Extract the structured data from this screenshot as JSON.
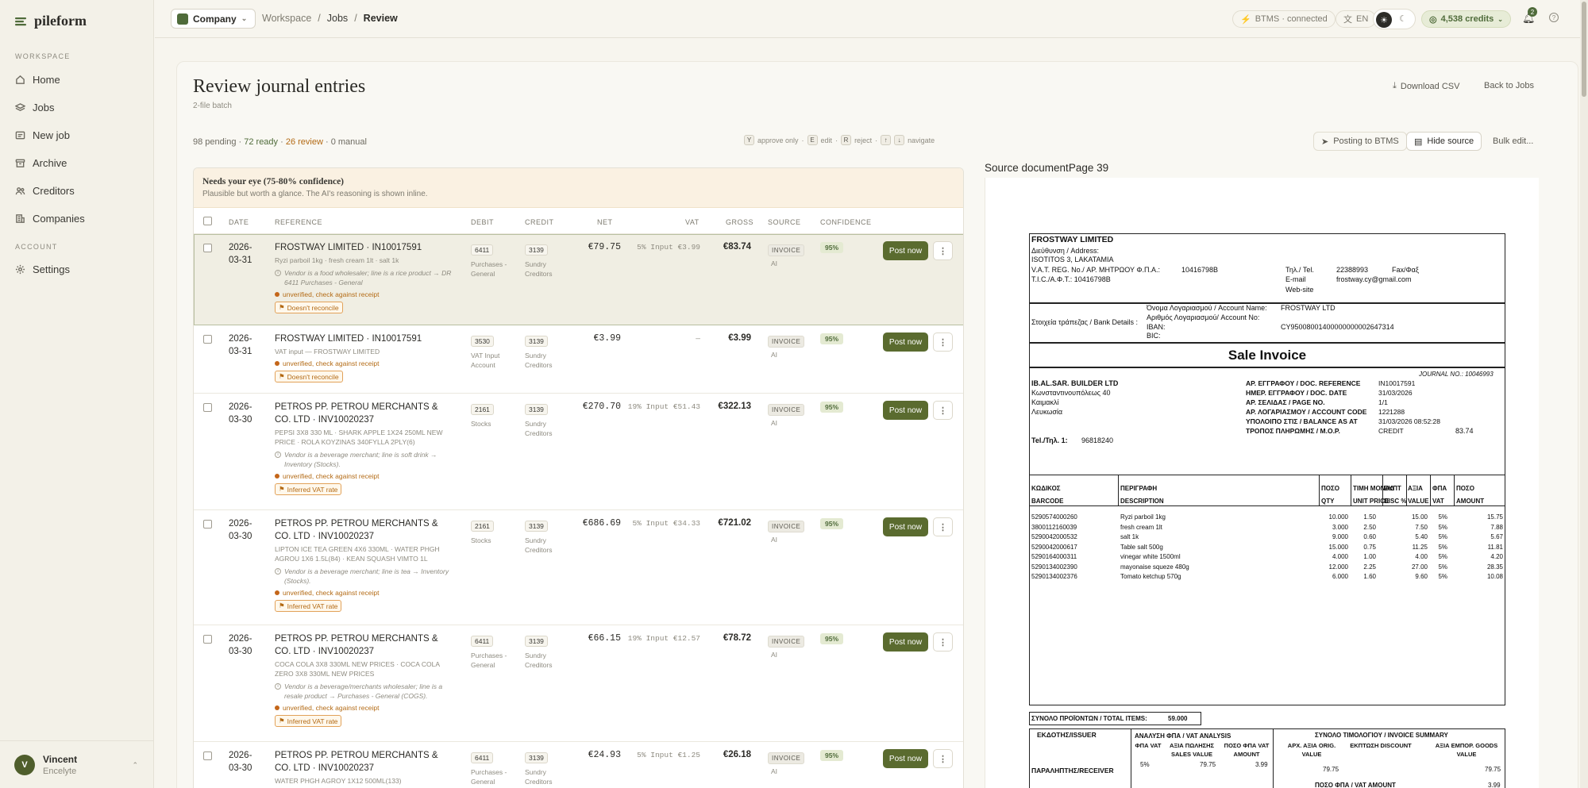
{
  "brand": {
    "name": "pileform"
  },
  "sidebar": {
    "workspace_label": "WORKSPACE",
    "items": [
      {
        "label": "Home",
        "icon": "home-icon"
      },
      {
        "label": "Jobs",
        "icon": "layers-icon"
      },
      {
        "label": "New job",
        "icon": "upload-icon"
      },
      {
        "label": "Archive",
        "icon": "archive-icon"
      },
      {
        "label": "Creditors",
        "icon": "users-icon"
      },
      {
        "label": "Companies",
        "icon": "building-icon"
      }
    ],
    "account_label": "ACCOUNT",
    "settings": {
      "label": "Settings",
      "icon": "gear-icon"
    },
    "user": {
      "initial": "V",
      "name": "Vincent",
      "org": "Encelyte"
    }
  },
  "topbar": {
    "company": "Company",
    "crumbs": [
      "Workspace",
      "/",
      "Jobs",
      "/",
      "Review"
    ],
    "btms": "BTMS · connected",
    "lang": "EN",
    "credits": "4,538 credits",
    "notifications": "2",
    "help": "?"
  },
  "page": {
    "title": "Review journal entries",
    "subtitle": "2-file batch",
    "download": "Download CSV",
    "back": "Back to Jobs",
    "stats": {
      "pending": "98 pending",
      "ready": "72 ready",
      "review": "26 review",
      "manual": "0 manual",
      "sep": " · "
    },
    "keys": [
      {
        "k": "Y",
        "label": "approve only"
      },
      {
        "k": "E",
        "label": "edit"
      },
      {
        "k": "R",
        "label": "reject"
      },
      {
        "k": "↑",
        "label": ""
      },
      {
        "k": "↓",
        "label": "navigate"
      }
    ],
    "posting": "Posting to BTMS",
    "hide_source": "Hide source",
    "bulk": "Bulk edit..."
  },
  "group": {
    "title": "Needs your eye (75-80% confidence)",
    "subtitle": "Plausible but worth a glance. The AI's reasoning is shown inline."
  },
  "columns": [
    "DATE",
    "REFERENCE",
    "DEBIT",
    "CREDIT",
    "NET",
    "VAT",
    "GROSS",
    "SOURCE",
    "CONFIDENCE"
  ],
  "rows": [
    {
      "date": "2026-03-31",
      "vendor": "FROSTWAY LIMITED · IN10017591",
      "lines": "Ryzi parboil 1kg · fresh cream 1lt · salt 1k",
      "ai": "Vendor is a food wholesaler; line is a rice product → DR 6411 Purchases - General",
      "unverified": "unverified, check against receipt",
      "flag": "Doesn't reconcile",
      "debit_code": "6411",
      "debit_name": "Purchases - General",
      "credit_code": "3139",
      "credit_name": "Sundry Creditors",
      "net": "€79.75",
      "vat": "5% Input €3.99",
      "gross": "€83.74",
      "source": "INVOICE",
      "src_by": "AI",
      "confidence": "95%",
      "post": "Post now"
    },
    {
      "date": "2026-03-31",
      "vendor": "FROSTWAY LIMITED · IN10017591",
      "lines": "VAT input — FROSTWAY LIMITED",
      "ai": "",
      "unverified": "unverified, check against receipt",
      "flag": "Doesn't reconcile",
      "debit_code": "3530",
      "debit_name": "VAT Input Account",
      "credit_code": "3139",
      "credit_name": "Sundry Creditors",
      "net": "€3.99",
      "vat": "—",
      "gross": "€3.99",
      "source": "INVOICE",
      "src_by": "AI",
      "confidence": "95%",
      "post": "Post now"
    },
    {
      "date": "2026-03-30",
      "vendor": "PETROS PP. PETROU MERCHANTS & CO. LTD · INV10020237",
      "lines": "PEPSI 3X8 330 ML · SHARK APPLE 1X24 250ML NEW PRICE · ROLA KOYZINAS 340FYLLA 2PLY(6)",
      "ai": "Vendor is a beverage merchant; line is soft drink → Inventory (Stocks).",
      "unverified": "unverified, check against receipt",
      "flag": "Inferred VAT rate",
      "debit_code": "2161",
      "debit_name": "Stocks",
      "credit_code": "3139",
      "credit_name": "Sundry Creditors",
      "net": "€270.70",
      "vat": "19% Input €51.43",
      "gross": "€322.13",
      "source": "INVOICE",
      "src_by": "AI",
      "confidence": "95%",
      "post": "Post now"
    },
    {
      "date": "2026-03-30",
      "vendor": "PETROS PP. PETROU MERCHANTS & CO. LTD · INV10020237",
      "lines": "LIPTON ICE TEA GREEN 4X6 330ML · WATER PHGH AGROU 1X6 1.5L(84) · KEAN SQUASH VIMTO 1L",
      "ai": "Vendor is a beverage merchant; line is tea → Inventory (Stocks).",
      "unverified": "unverified, check against receipt",
      "flag": "Inferred VAT rate",
      "debit_code": "2161",
      "debit_name": "Stocks",
      "credit_code": "3139",
      "credit_name": "Sundry Creditors",
      "net": "€686.69",
      "vat": "5% Input €34.33",
      "gross": "€721.02",
      "source": "INVOICE",
      "src_by": "AI",
      "confidence": "95%",
      "post": "Post now"
    },
    {
      "date": "2026-03-30",
      "vendor": "PETROS PP. PETROU MERCHANTS & CO. LTD · INV10020237",
      "lines": "COCA COLA 3X8 330ML NEW PRICES · COCA COLA ZERO 3X8 330ML NEW PRICES",
      "ai": "Vendor is a beverage/merchants wholesaler; line is a resale product → Purchases - General (COGS).",
      "unverified": "unverified, check against receipt",
      "flag": "Inferred VAT rate",
      "debit_code": "6411",
      "debit_name": "Purchases - General",
      "credit_code": "3139",
      "credit_name": "Sundry Creditors",
      "net": "€66.15",
      "vat": "19% Input €12.57",
      "gross": "€78.72",
      "source": "INVOICE",
      "src_by": "AI",
      "confidence": "95%",
      "post": "Post now"
    },
    {
      "date": "2026-03-30",
      "vendor": "PETROS PP. PETROU MERCHANTS & CO. LTD · INV10020237",
      "lines": "WATER PHGH AGROY 1X12 500ML(133)",
      "ai": "",
      "unverified": "",
      "flag": "",
      "debit_code": "6411",
      "debit_name": "Purchases - General",
      "credit_code": "3139",
      "credit_name": "Sundry Creditors",
      "net": "€24.93",
      "vat": "5% Input €1.25",
      "gross": "€26.18",
      "source": "INVOICE",
      "src_by": "AI",
      "confidence": "95%",
      "post": "Post now"
    }
  ],
  "source_pane": {
    "label": "Source document",
    "page": "Page 39"
  },
  "doc": {
    "seller": "FROSTWAY LIMITED",
    "address_label": "Διεύθυνση / Address:",
    "address": "ISOTITOS 3, LAKATAMIA",
    "vat_reg": "V.A.T. REG. No./ ΑΡ. ΜΗΤΡΩΟΥ Φ.Π.Α.:",
    "vat_no": "10416798B",
    "tic": "T.I.C./Α.Φ.Τ.: 10416798B",
    "tel_label": "Τηλ./ Tel.",
    "tel": "22388993",
    "fax": "Fax/Φαξ",
    "email_label": "E-mail",
    "email": "frostway.cy@gmail.com",
    "web": "Web-site",
    "acct_name_label": "Όνομα Λογαριασμού / Account Name:",
    "acct_name": "FROSTWAY LTD",
    "bank_label": "Στοιχεία τράπεζας / Bank Details :",
    "acct_no_label": "Αριθμός Λογαριασμού/ Account No:",
    "iban_label": "IBAN:",
    "iban": "CY95008001400000000002647314",
    "bic_label": "BIC:",
    "heading": "Sale Invoice",
    "journal": "JOURNAL NO.: 10046993",
    "buyer": "IB.AL.SAR. BUILDER LTD",
    "buyer_addr1": "Κωνσταντινουπόλεως 40",
    "buyer_addr2": "Καιμακλί",
    "buyer_addr3": "Λευκωσία",
    "buyer_tel": "Tel./Τηλ. 1:",
    "buyer_tel_no": "96818240",
    "meta": [
      {
        "k": "ΑΡ. ΕΓΓΡΑΦΟΥ / DOC. REFERENCE",
        "v": "IN10017591"
      },
      {
        "k": "ΗΜΕΡ. ΕΓΓΡΑΦΟΥ / DOC. DATE",
        "v": "31/03/2026"
      },
      {
        "k": "ΑΡ. ΣΕΛΙΔΑΣ / PAGE NO.",
        "v": "1/1"
      },
      {
        "k": "ΑΡ. ΛΟΓΑΡΙΑΣΜΟΥ / ACCOUNT CODE",
        "v": "1221288"
      },
      {
        "k": "ΥΠΟΛΟΙΠΟ ΣΤΙΣ / BALANCE AS AT",
        "v": "31/03/2026 08:52:28"
      },
      {
        "k": "ΤΡΟΠΟΣ ΠΛΗΡΩΜΗΣ / M.O.P.",
        "v": "CREDIT"
      }
    ],
    "balance": "83.74",
    "cols": {
      "code": "ΚΩΔΙΚΟΣ",
      "barcode": "BARCODE",
      "desc_gr": "ΠΕΡΙΓΡΑΦΗ",
      "desc": "DESCRIPTION",
      "qty_gr": "ΠΟΣΟ",
      "qty": "QTY",
      "up_gr": "ΤΙΜΗ ΜΟΝΑΔ",
      "up": "UNIT PRICE",
      "disc_gr": "ΕΚΠΤ",
      "disc": "DISC %",
      "val_gr": "ΑΞΙΑ",
      "val": "VALUE",
      "vat_gr": "ΦΠΑ",
      "vat": "VAT",
      "amt_gr": "ΠΟΣΟ",
      "amt": "AMOUNT"
    },
    "items": [
      {
        "bc": "5290574000260",
        "d": "Ryzi parboil 1kg",
        "q": "10.000",
        "p": "1.50",
        "v": "15.00",
        "t": "5%",
        "a": "15.75"
      },
      {
        "bc": "3800112160039",
        "d": "fresh cream 1lt",
        "q": "3.000",
        "p": "2.50",
        "v": "7.50",
        "t": "5%",
        "a": "7.88"
      },
      {
        "bc": "5290042000532",
        "d": "salt 1k",
        "q": "9.000",
        "p": "0.60",
        "v": "5.40",
        "t": "5%",
        "a": "5.67"
      },
      {
        "bc": "5290042000617",
        "d": "Table salt 500g",
        "q": "15.000",
        "p": "0.75",
        "v": "11.25",
        "t": "5%",
        "a": "11.81"
      },
      {
        "bc": "5290164000311",
        "d": "vinegar white 1500ml",
        "q": "4.000",
        "p": "1.00",
        "v": "4.00",
        "t": "5%",
        "a": "4.20"
      },
      {
        "bc": "5290134002390",
        "d": "mayonaise squeze 480g",
        "q": "12.000",
        "p": "2.25",
        "v": "27.00",
        "t": "5%",
        "a": "28.35"
      },
      {
        "bc": "5290134002376",
        "d": "Tomato ketchup 570g",
        "q": "6.000",
        "p": "1.60",
        "v": "9.60",
        "t": "5%",
        "a": "10.08"
      }
    ],
    "total_items_label": "ΣΥΝΟΛΟ ΠΡΟΪΟΝΤΩΝ / TOTAL ITEMS:",
    "total_items": "59.000",
    "issuer": "ΕΚΔΟΤΗΣ/ISSUER",
    "vat_analysis": "ΑΝΑΛΥΣΗ ΦΠΑ / VAT ANALYSIS",
    "va_cols": [
      "ΦΠΑ VAT",
      "ΑΞΙΑ ΠΩΛΗΣΗΣ SALES VALUE",
      "ΠΟΣΟ ΦΠΑ VAT AMOUNT"
    ],
    "va_row": [
      "5%",
      "79.75",
      "3.99"
    ],
    "summary": "ΣΥΝΟΛΟ ΤΙΜΟΛΟΓΙΟΥ / INVOICE SUMMARY",
    "sum_cols": [
      "ΑΡΧ. ΑΞΙΑ ORIG. VALUE",
      "ΕΚΠΤΩΣΗ DISCOUNT",
      "ΑΞΙΑ ΕΜΠΟΡ. GOODS VALUE"
    ],
    "sum_row": [
      "79.75",
      "",
      "79.75"
    ],
    "receiver": "ΠΑΡΑΛΗΠΤΗΣ/RECEIVER",
    "vat_amount_label": "ΠΟΣΟ ΦΠΑ / VAT AMOUNT",
    "vat_amount": "3.99"
  }
}
